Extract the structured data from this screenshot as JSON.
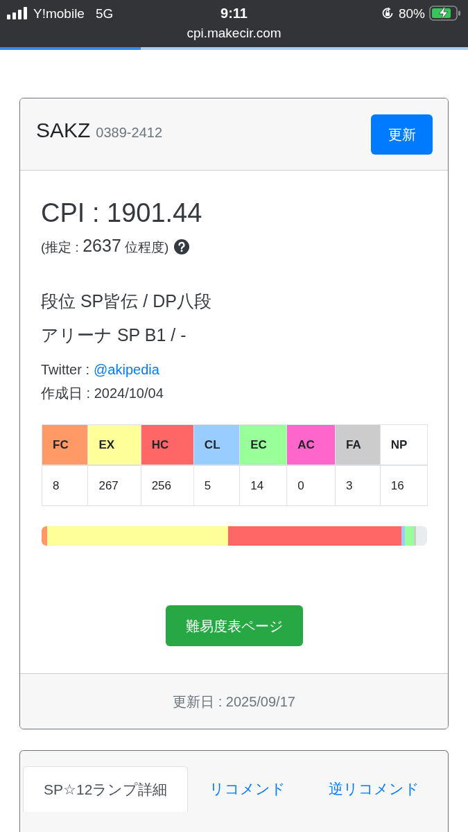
{
  "status_bar": {
    "carrier": "Y!mobile",
    "network": "5G",
    "time": "9:11",
    "battery": "80%",
    "url": "cpi.makecir.com"
  },
  "page_load": {
    "level": 0.3
  },
  "profile_card": {
    "name": "SAKZ",
    "player_id": "0389-2412",
    "update_button": "更新",
    "cpi": "CPI : 1901.44",
    "rank_prefix": "(推定 :",
    "rank": "2637",
    "rank_suffix": "位程度)",
    "dan": "段位 SP皆伝 / DP八段",
    "arena": "アリーナ SP B1 / -",
    "twitter_label": "Twitter :",
    "twitter_handle": "@akipedia",
    "created": "作成日 : 2024/10/04",
    "lamps": [
      {
        "label": "FC",
        "count": "8",
        "color": "#ff9966"
      },
      {
        "label": "EX",
        "count": "267",
        "color": "#ffff99"
      },
      {
        "label": "HC",
        "count": "256",
        "color": "#ff6666"
      },
      {
        "label": "CL",
        "count": "5",
        "color": "#99ccff"
      },
      {
        "label": "EC",
        "count": "14",
        "color": "#99ff99"
      },
      {
        "label": "AC",
        "count": "0",
        "color": "#ff66cc"
      },
      {
        "label": "FA",
        "count": "3",
        "color": "#cccccc"
      },
      {
        "label": "NP",
        "count": "16",
        "color": "#ffffff"
      }
    ],
    "difficulty_button": "難易度表ページ",
    "updated": "更新日 : 2025/09/17"
  },
  "detail_card": {
    "tabs": [
      {
        "label": "SP☆12ランプ詳細",
        "selected": true
      },
      {
        "label": "リコメンド",
        "selected": false
      },
      {
        "label": "逆リコメンド",
        "selected": false
      }
    ]
  }
}
